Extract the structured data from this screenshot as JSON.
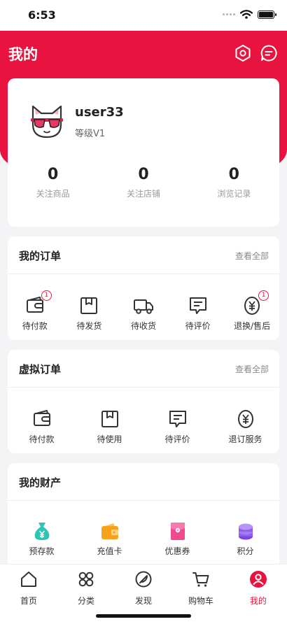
{
  "status_bar": {
    "time": "6:53"
  },
  "header": {
    "title": "我的",
    "settings_icon": "settings-hex-icon",
    "message_icon": "message-bubble-icon"
  },
  "colors": {
    "primary": "#e8143f",
    "background": "#f4f4f6"
  },
  "profile": {
    "username": "user33",
    "level": "等级V1",
    "avatar_icon": "cat-with-sunglasses-avatar",
    "stats": [
      {
        "value": "0",
        "label": "关注商品"
      },
      {
        "value": "0",
        "label": "关注店铺"
      },
      {
        "value": "0",
        "label": "浏览记录"
      }
    ]
  },
  "my_orders": {
    "title": "我的订单",
    "more": "查看全部",
    "items": [
      {
        "label": "待付款",
        "icon": "wallet-icon",
        "badge": "1"
      },
      {
        "label": "待发货",
        "icon": "box-icon"
      },
      {
        "label": "待收货",
        "icon": "truck-icon"
      },
      {
        "label": "待评价",
        "icon": "comment-icon"
      },
      {
        "label": "退换/售后",
        "icon": "yen-refund-icon",
        "badge": "1"
      }
    ]
  },
  "virtual_orders": {
    "title": "虚拟订单",
    "more": "查看全部",
    "items": [
      {
        "label": "待付款",
        "icon": "wallet-icon"
      },
      {
        "label": "待使用",
        "icon": "box-icon"
      },
      {
        "label": "待评价",
        "icon": "comment-icon"
      },
      {
        "label": "退订服务",
        "icon": "yen-refund-icon"
      }
    ]
  },
  "assets": {
    "title": "我的财产",
    "items": [
      {
        "label": "预存款",
        "icon": "money-bag-icon",
        "color": "#2ec4b6"
      },
      {
        "label": "充值卡",
        "icon": "recharge-card-icon",
        "color": "#f7a21b"
      },
      {
        "label": "优惠券",
        "icon": "coupon-icon",
        "color": "#f0498f"
      },
      {
        "label": "积分",
        "icon": "points-stack-icon",
        "color": "#8e5cf0"
      }
    ]
  },
  "tabbar": {
    "items": [
      {
        "label": "首页",
        "icon": "home-icon"
      },
      {
        "label": "分类",
        "icon": "category-icon"
      },
      {
        "label": "发现",
        "icon": "discover-icon"
      },
      {
        "label": "购物车",
        "icon": "cart-icon"
      },
      {
        "label": "我的",
        "icon": "user-icon",
        "active": true
      }
    ]
  }
}
